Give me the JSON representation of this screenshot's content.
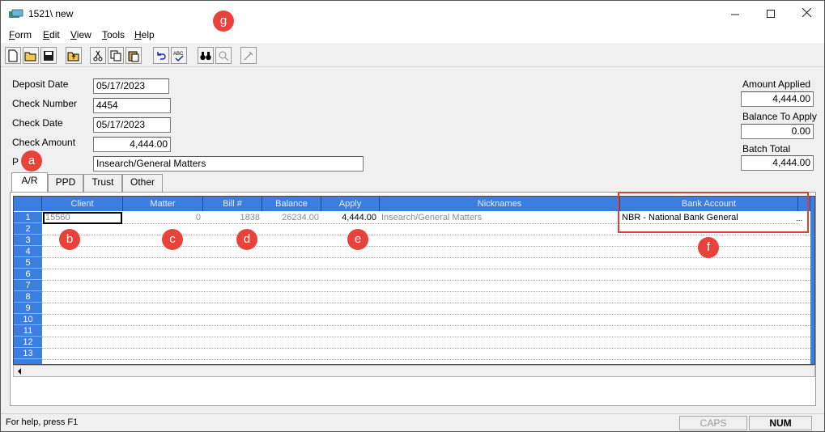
{
  "window": {
    "title": "1521\\ new"
  },
  "menu": [
    {
      "label": "Form",
      "key": "F",
      "rest": "orm"
    },
    {
      "label": "Edit",
      "key": "E",
      "rest": "dit"
    },
    {
      "label": "View",
      "key": "V",
      "rest": "iew"
    },
    {
      "label": "Tools",
      "key": "T",
      "rest": "ools"
    },
    {
      "label": "Help",
      "key": "H",
      "rest": "elp"
    }
  ],
  "toolbar_icons": [
    "new-icon",
    "open-icon",
    "save-icon",
    "up-folder-icon",
    "cut-icon",
    "copy-icon",
    "paste-icon",
    "undo-icon",
    "spellcheck-icon",
    "binoculars-icon",
    "zoom-icon",
    "disabled-tool-icon"
  ],
  "form": {
    "deposit_date": {
      "label": "Deposit Date",
      "value": "05/17/2023"
    },
    "check_number": {
      "label": "Check Number",
      "value": "4454"
    },
    "check_date": {
      "label": "Check Date",
      "value": "05/17/2023"
    },
    "check_amount": {
      "label": "Check Amount",
      "value": "4,444.00"
    },
    "payor": {
      "label": "P",
      "value": "Insearch/General Matters"
    }
  },
  "summary": {
    "amount_applied": {
      "label": "Amount Applied",
      "value": "4,444.00"
    },
    "balance_to_apply": {
      "label": "Balance To Apply",
      "value": "0.00"
    },
    "batch_total": {
      "label": "Batch Total",
      "value": "4,444.00"
    }
  },
  "tabs": [
    "A/R",
    "PPD",
    "Trust",
    "Other"
  ],
  "grid": {
    "columns": [
      "Client",
      "Matter",
      "Bill #",
      "Balance",
      "Apply",
      "Nicknames",
      "Bank Account"
    ],
    "row_numbers": [
      "1",
      "2",
      "3",
      "4",
      "5",
      "6",
      "7",
      "8",
      "9",
      "10",
      "11",
      "12",
      "13"
    ],
    "rows": [
      {
        "client": "15560",
        "matter": "0",
        "bill": "1838",
        "balance": "26234.00",
        "apply": "4,444.00",
        "nickname": "Insearch/General Matters",
        "bank_account": "NBR - National Bank General",
        "ellipsis": "..."
      }
    ]
  },
  "status": {
    "help": "For help, press F1",
    "caps": "CAPS",
    "num": "NUM"
  },
  "badges": [
    "a",
    "b",
    "c",
    "d",
    "e",
    "f",
    "g"
  ],
  "colors": {
    "grid_header": "#3c7de0",
    "badge": "#e8433a",
    "highlight": "#d9403a"
  }
}
